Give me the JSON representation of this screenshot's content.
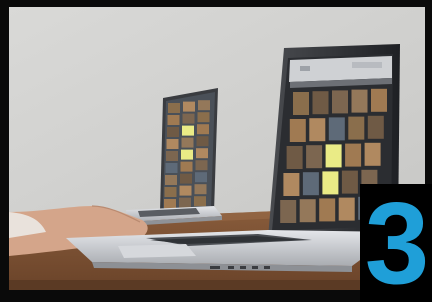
{
  "colors": {
    "border": "#0a0a0a",
    "wall": "#d3d3d1",
    "table": "#7a5236",
    "laptop_silver": "#c9cbcf",
    "screen_dark": "#2a2c30",
    "thumb_yellow": "#eaeb86",
    "badge_bg": "#000000",
    "badge_digit": "#1f9fd8"
  },
  "badge": {
    "number": "3"
  }
}
